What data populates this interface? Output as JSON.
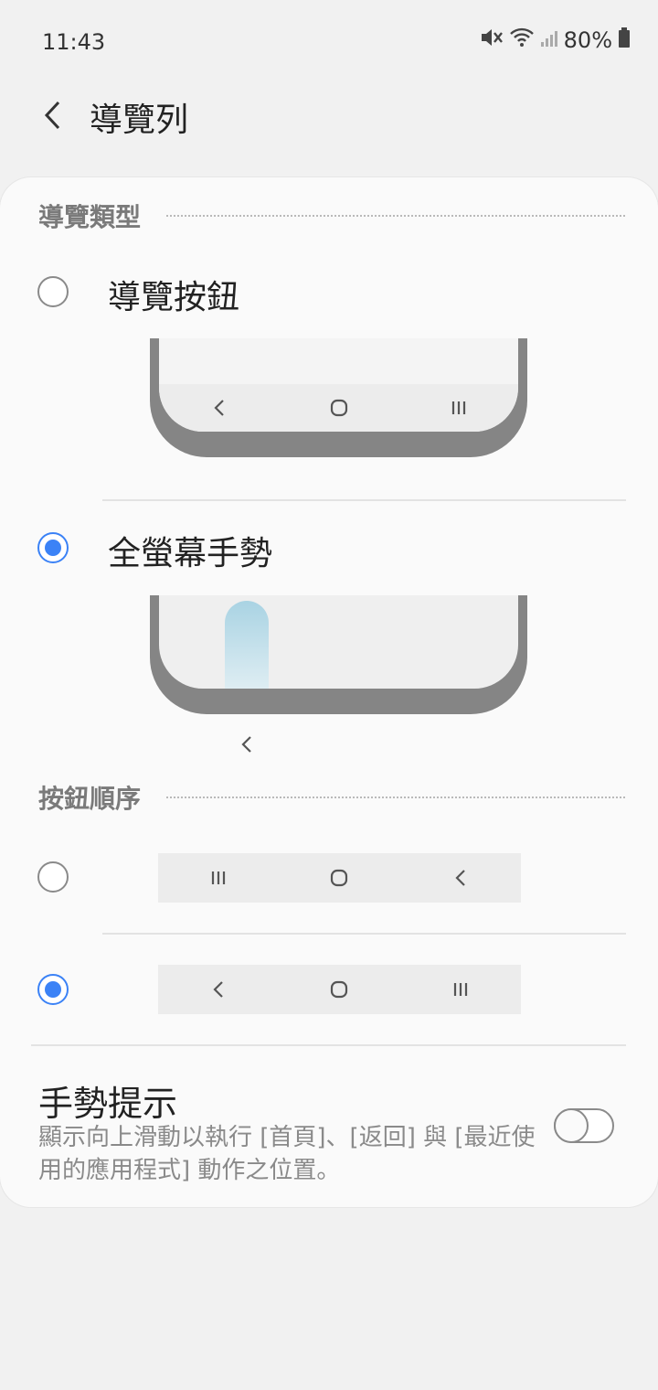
{
  "status_bar": {
    "time": "11:43",
    "battery": "80%",
    "icons": [
      "mute-icon",
      "wifi-icon",
      "signal-icon",
      "battery-icon"
    ]
  },
  "app_bar": {
    "back_icon": "chevron-left-icon",
    "title": "導覽列"
  },
  "nav_type": {
    "header": "導覽類型",
    "options": [
      {
        "label": "導覽按鈕",
        "selected": false,
        "preview_icons": [
          "back-icon",
          "home-icon",
          "recents-icon"
        ]
      },
      {
        "label": "全螢幕手勢",
        "selected": true,
        "preview_icons": [
          "back-icon"
        ]
      }
    ]
  },
  "button_order": {
    "header": "按鈕順序",
    "options": [
      {
        "selected": false,
        "icons": [
          "recents-icon",
          "home-icon",
          "back-icon"
        ]
      },
      {
        "selected": true,
        "icons": [
          "back-icon",
          "home-icon",
          "recents-icon"
        ]
      }
    ]
  },
  "gesture_hint": {
    "title": "手勢提示",
    "description": "顯示向上滑動以執行 [首頁]、[返回] 與 [最近使用的應用程式] 動作之位置。",
    "enabled": false
  },
  "colors": {
    "accent": "#3b82f6",
    "background": "#f1f1f1",
    "card": "#fafafa"
  }
}
